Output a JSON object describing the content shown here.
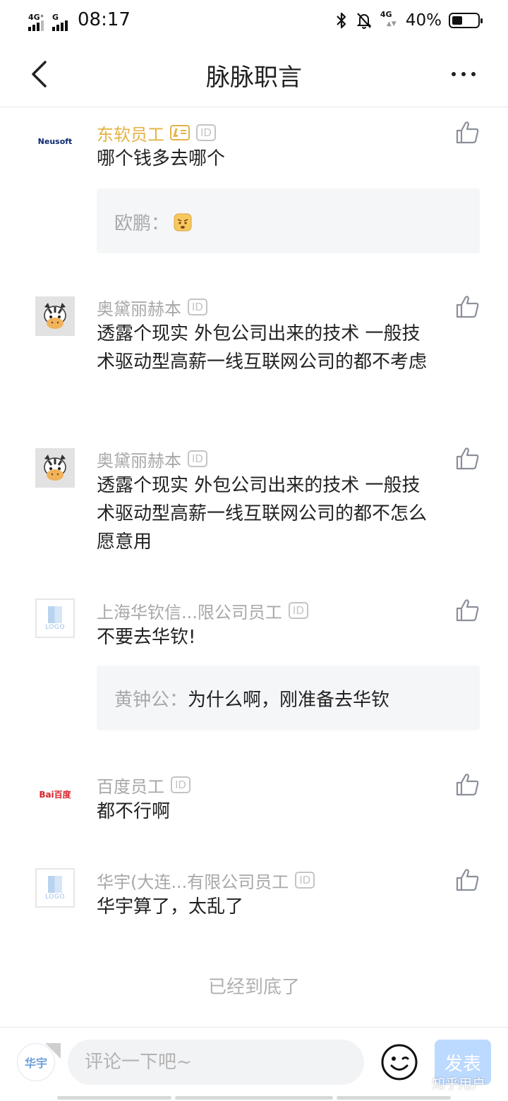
{
  "status_bar": {
    "sim1_type": "4G⁺",
    "sim2_type": "G",
    "time": "08:17",
    "net_type": "4G",
    "battery_percent": "40%",
    "battery_level": 0.4
  },
  "nav": {
    "title": "脉脉职言"
  },
  "comments": [
    {
      "avatar_text": "Neusoft",
      "author": "东软员工",
      "id_badge": "ID",
      "verified": true,
      "text": "哪个钱多去哪个",
      "reply": {
        "name": "欧鹏：",
        "text": ""
      }
    },
    {
      "author": "奥黛丽赫本",
      "id_badge": "ID",
      "text": "透露个现实 外包公司出来的技术 一般技术驱动型高薪一线互联网公司的都不考虑"
    },
    {
      "author": "奥黛丽赫本",
      "id_badge": "ID",
      "text": "透露个现实 外包公司出来的技术 一般技术驱动型高薪一线互联网公司的都不怎么愿意用"
    },
    {
      "avatar_text": "LOGO",
      "author": "上海华钦信...限公司员工",
      "id_badge": "ID",
      "text": "不要去华钦!",
      "reply": {
        "name": "黄钟公：",
        "text": "为什么啊，刚准备去华钦"
      }
    },
    {
      "avatar_text": "Bai百度",
      "author": "百度员工",
      "id_badge": "ID",
      "text": "都不行啊"
    },
    {
      "avatar_text": "LOGO",
      "author": "华宇(大连...有限公司员工",
      "id_badge": "ID",
      "text": "华宇算了，太乱了"
    }
  ],
  "footer": {
    "end_text": "已经到底了"
  },
  "bottom_bar": {
    "my_avatar_text": "华宇",
    "input_placeholder": "评论一下吧~",
    "publish_label": "发表",
    "watermark": "知乎用户"
  },
  "colors": {
    "verified_author": "#e3b245",
    "muted_author": "#a8a8a8",
    "reply_bg": "#f5f6f8",
    "publish_bg": "#bcd9ff"
  }
}
